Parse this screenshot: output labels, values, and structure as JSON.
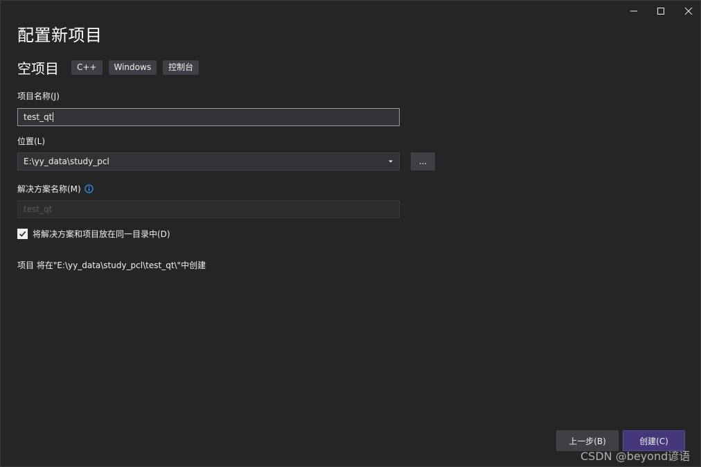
{
  "window": {
    "title": "配置新项目",
    "controls": {
      "minimize_icon": "minimize-icon",
      "maximize_icon": "maximize-icon",
      "close_icon": "close-icon"
    }
  },
  "template": {
    "name": "空项目",
    "tags": [
      "C++",
      "Windows",
      "控制台"
    ]
  },
  "form": {
    "project_name_label": "项目名称(J)",
    "project_name_value": "test_qt",
    "location_label": "位置(L)",
    "location_value": "E:\\yy_data\\study_pcl",
    "browse_label": "...",
    "solution_name_label": "解决方案名称(M)",
    "solution_name_value": "test_qt",
    "same_dir_label": "将解决方案和项目放在同一目录中(D)",
    "same_dir_checked": true,
    "summary": "项目 将在\"E:\\yy_data\\study_pcl\\test_qt\\\"中创建"
  },
  "footer": {
    "back_label": "上一步(B)",
    "create_label": "创建(C)"
  },
  "watermark": "CSDN @beyond谚语",
  "colors": {
    "background": "#252526",
    "accent": "#46367a",
    "info": "#3794ff"
  }
}
